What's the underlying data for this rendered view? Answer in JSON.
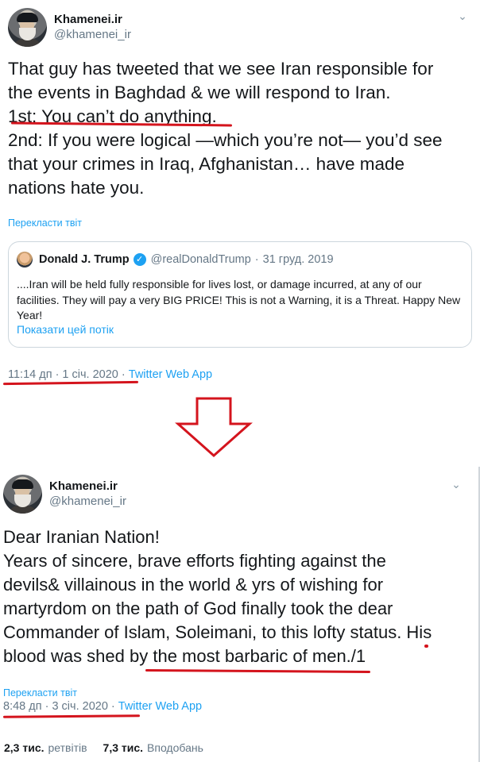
{
  "tweet1": {
    "display_name": "Khamenei.ir",
    "handle": "@khamenei_ir",
    "text_lines": [
      "That guy has tweeted that we see Iran responsible for",
      "the events in Baghdad & we will respond to Iran.",
      "1st: You can’t do anything.",
      "2nd: If you were logical —which you’re not— you’d see",
      "that your crimes in Iraq, Afghanistan… have made",
      "nations hate you."
    ],
    "translate_label": "Перекласти твіт",
    "quote": {
      "name": "Donald J. Trump",
      "verified_icon": "✓",
      "handle": "@realDonaldTrump",
      "separator": "·",
      "date": "31 груд. 2019",
      "text": "....Iran will be held fully responsible for lives lost, or damage incurred, at any of our facilities. They will pay a very BIG PRICE! This is not a Warning, it is a Threat. Happy New Year!",
      "show_thread": "Показати цей потік"
    },
    "time": "11:14 дп · 1 січ. 2020 · ",
    "app": "Twitter Web App"
  },
  "tweet2": {
    "display_name": "Khamenei.ir",
    "handle": "@khamenei_ir",
    "text_lines": [
      "Dear Iranian Nation!",
      "Years of sincere, brave efforts fighting against the",
      "devils& villainous in the world & yrs of wishing for",
      "martyrdom on the path of God finally took the dear",
      "Commander of Islam, Soleimani, to this lofty status. His",
      "blood was shed by the most barbaric of men./1"
    ],
    "translate_label": "Перекласти твіт",
    "time": "8:48 дп · 3 січ. 2020 · ",
    "app": "Twitter Web App",
    "retweets_count": "2,3 тис.",
    "retweets_label": "ретвітів",
    "likes_count": "7,3 тис.",
    "likes_label": "Вподобань"
  },
  "colors": {
    "accent": "#1da1f2",
    "annotation_red": "#d4141d",
    "secondary_text": "#657786"
  },
  "icons": {
    "caret": "chevron-down-icon",
    "verified": "verified-badge-icon",
    "arrow": "down-arrow-annotation"
  }
}
